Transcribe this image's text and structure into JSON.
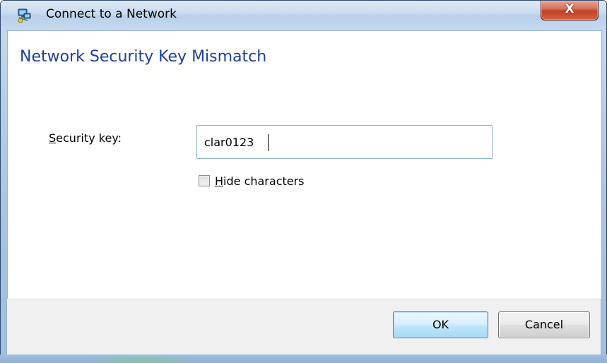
{
  "window": {
    "title": "Connect to a Network",
    "icon": "network-connect-icon",
    "close_symbol": "X"
  },
  "main": {
    "heading": "Network Security Key Mismatch",
    "security_key": {
      "label_accel": "S",
      "label_rest": "ecurity key:",
      "value": "clar0123"
    },
    "hide_characters": {
      "label_accel": "H",
      "label_rest": "ide characters",
      "checked": false
    }
  },
  "buttons": {
    "ok_label": "OK",
    "cancel_label": "Cancel"
  },
  "colors": {
    "heading": "#1e3f9c",
    "close_button": "#c24127",
    "ok_button_border": "#3c7fb1"
  }
}
